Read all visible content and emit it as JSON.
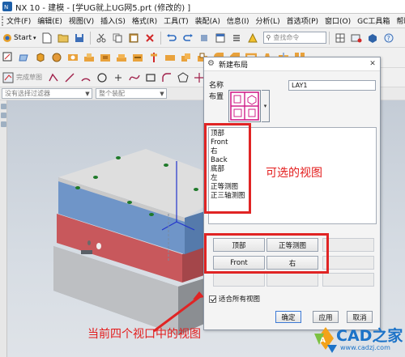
{
  "titlebar": {
    "title": "NX 10 - 建模 - [学UG就上UG网5.prt  (修改的) ]",
    "minimize": "–",
    "maximize": "□",
    "close": "✕"
  },
  "menubar": {
    "items": [
      "文件(F)",
      "编辑(E)",
      "视图(V)",
      "插入(S)",
      "格式(R)",
      "工具(T)",
      "装配(A)",
      "信息(I)",
      "分析(L)",
      "首选项(P)",
      "窗口(O)",
      "GC工具箱",
      "帮助(H)"
    ]
  },
  "toolbar1": {
    "start_label": "Start",
    "search_placeholder": "查找命令"
  },
  "toolbar3": {
    "sketch_label": "完成草图"
  },
  "filterbar": {
    "filter_placeholder": "没有选择过滤器",
    "assembly_placeholder": "整个装配"
  },
  "dialog": {
    "title": "新建布局",
    "name_label": "名称",
    "name_value": "LAY1",
    "layout_label": "布置",
    "views": [
      "顶部",
      "Front",
      "右",
      "Back",
      "底部",
      "左",
      "正等测图",
      "正三轴测图"
    ],
    "viewports": {
      "top_left": "顶部",
      "top_right": "正等测图",
      "bottom_left": "Front",
      "bottom_right": "右"
    },
    "fit_all_label": "适合所有视图",
    "ok_label": "确定",
    "apply_label": "应用",
    "cancel_label": "取消"
  },
  "annotations": {
    "selectable_views": "可选的视图",
    "current_views": "当前四个视口中的视图"
  },
  "watermark": {
    "brand": "CAD之家",
    "url": "www.cadzj.com"
  },
  "colors": {
    "annotation_red": "#e02424",
    "plate_top": "#dedede",
    "plate_blue": "#6f95c8",
    "plate_red": "#c8585c",
    "hole_green": "#1f7a2a",
    "brand_blue": "#1c73c8"
  }
}
